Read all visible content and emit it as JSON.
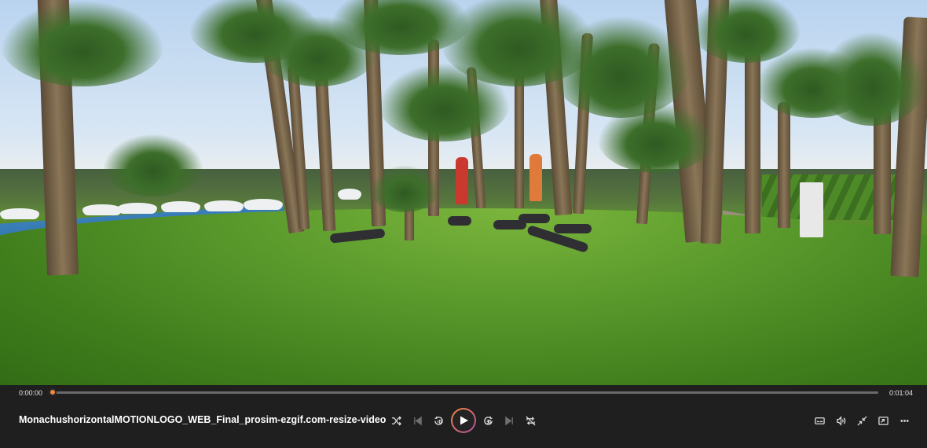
{
  "player": {
    "current_time": "0:00:00",
    "total_time": "0:01:04",
    "progress": 0.003,
    "title": "MonachushorizontalMOTIONLOGO_WEB_Final_prosim-ezgif.com-resize-video",
    "accent_color": "#e47a3c"
  },
  "controls": {
    "left": [
      "shuffle-icon",
      "previous-icon",
      "rewind-10-icon",
      "play-icon",
      "forward-30-icon",
      "next-icon",
      "repeat-off-icon"
    ],
    "right": [
      "subtitles-icon",
      "volume-icon",
      "fullscreen-exit-icon",
      "mini-player-icon",
      "more-icon"
    ]
  }
}
